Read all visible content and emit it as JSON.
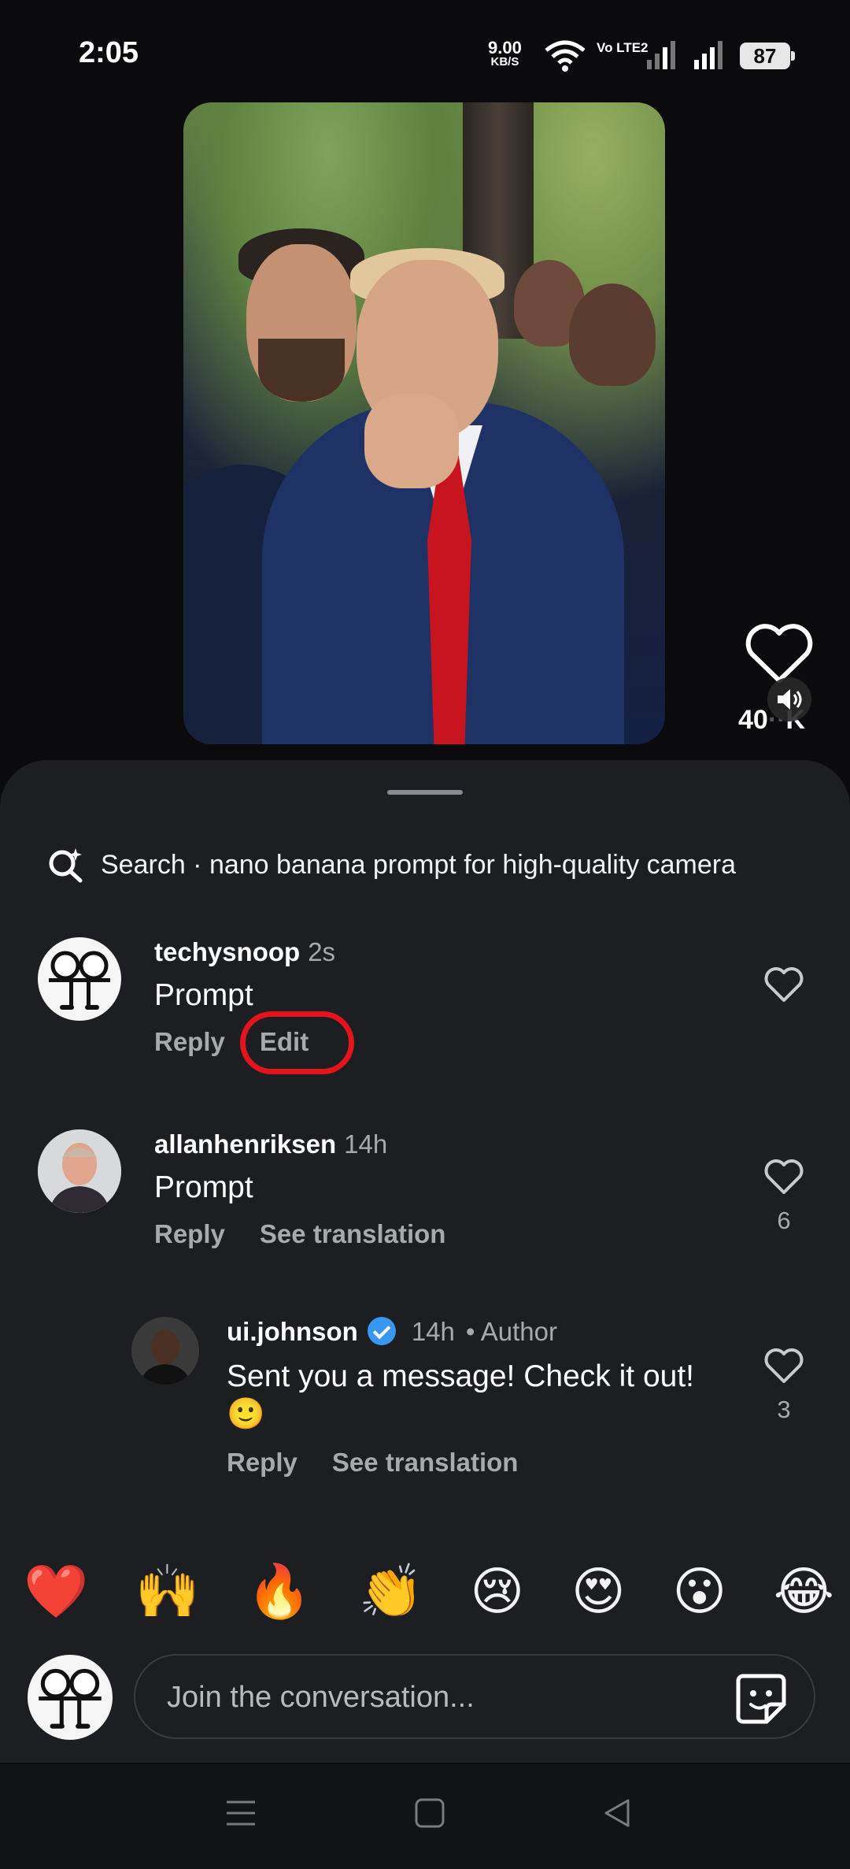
{
  "status_bar": {
    "time": "2:05",
    "net_speed": "9.00",
    "net_unit": "KB/S",
    "volte": "Vo LTE2",
    "battery": "87"
  },
  "video": {
    "like_count": "40",
    "like_count_suffix": "K",
    "icons": [
      "heart-icon",
      "volume-icon"
    ]
  },
  "search": {
    "label": "Search · nano banana prompt for high-quality camera"
  },
  "comments": [
    {
      "username": "techysnoop",
      "time": "2s",
      "text": "Prompt",
      "actions": [
        "Reply",
        "Edit"
      ],
      "likes": ""
    },
    {
      "username": "allanhenriksen",
      "time": "14h",
      "text": "Prompt",
      "actions": [
        "Reply",
        "See translation"
      ],
      "likes": "6"
    },
    {
      "username": "ui.johnson",
      "time": "14h",
      "author_tag": "• Author",
      "text": "Sent you a message! Check it out!🙂",
      "actions": [
        "Reply",
        "See translation"
      ],
      "likes": "3",
      "verified": true
    }
  ],
  "emoji_bar": [
    "❤️",
    "🙌",
    "🔥",
    "👏",
    "😢",
    "😍",
    "😮",
    "😂"
  ],
  "composer": {
    "placeholder": "Join the conversation..."
  },
  "colors": {
    "sheet_bg": "#1d1e22",
    "highlight_ring": "#e3141b",
    "verified_blue": "#3897f0"
  }
}
